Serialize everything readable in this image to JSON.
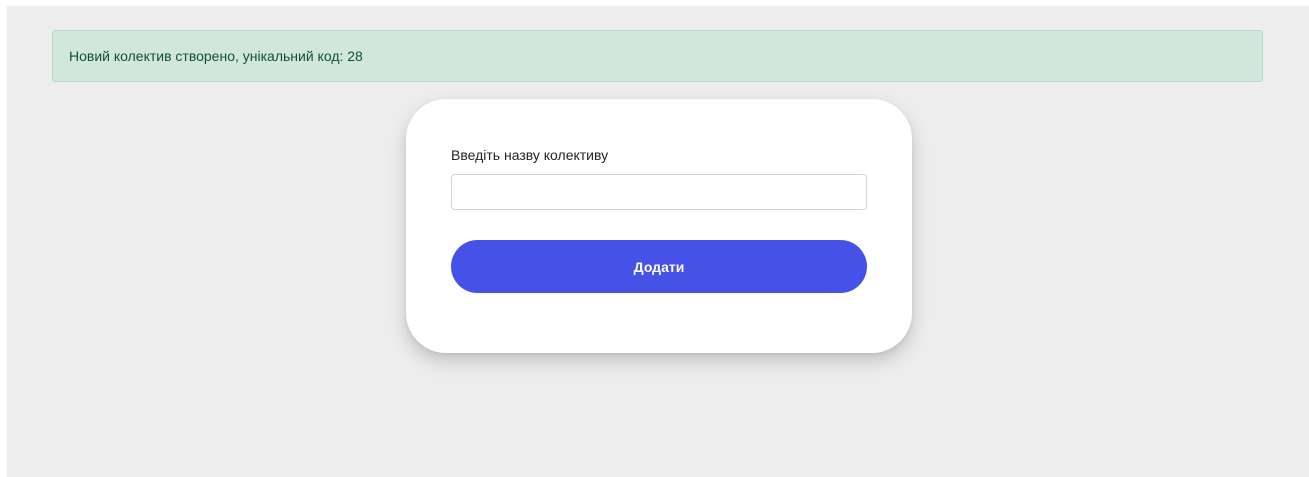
{
  "alert": {
    "message": "Новий колектив створено, унікальний код: 28"
  },
  "form": {
    "label": "Введіть назву колективу",
    "input_value": "",
    "input_placeholder": "",
    "submit_label": "Додати"
  },
  "colors": {
    "alert_background": "#d1e7dd",
    "alert_text": "#0f5132",
    "accent": "#4651e8",
    "page_background": "#ededed"
  }
}
